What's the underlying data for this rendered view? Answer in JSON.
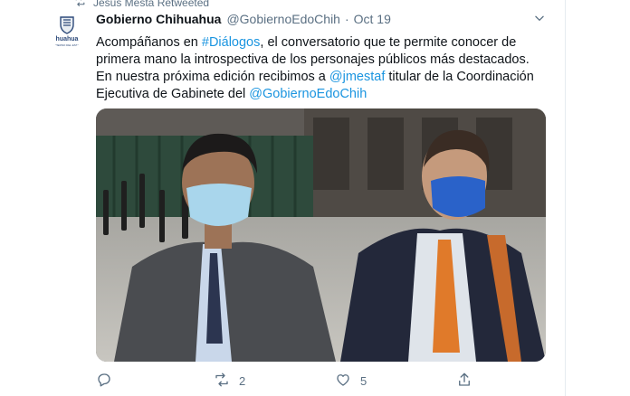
{
  "retweet_banner": {
    "text": "Jesus Mesta Retweeted",
    "icon": "retweet-icon"
  },
  "author": {
    "display_name": "Gobierno Chihuahua",
    "handle": "@GobiernoEdoChih",
    "separator": "·",
    "date": "Oct 19",
    "avatar_text": "huahua",
    "avatar_subtext": "GOBIERNO DEL ESTADO"
  },
  "tweet": {
    "t1": "Acompáñanos en ",
    "hashtag": "#Diálogos",
    "t2": ", el conversatorio que te permite conocer de primera mano la introspectiva de los personajes públicos más destacados. En nuestra próxima edición recibimos a ",
    "mention1": "@jmestaf",
    "t3": " titular de la Coordinación Ejecutiva de Gabinete del ",
    "mention2": "@GobiernoEdoChih"
  },
  "actions": {
    "reply_count": "",
    "retweet_count": "2",
    "like_count": "5"
  },
  "colors": {
    "link": "#1b95e0",
    "muted": "#5b7083",
    "text": "#0f1419"
  },
  "icons": [
    "retweet-icon",
    "more-icon",
    "reply-icon",
    "like-icon",
    "share-icon"
  ]
}
